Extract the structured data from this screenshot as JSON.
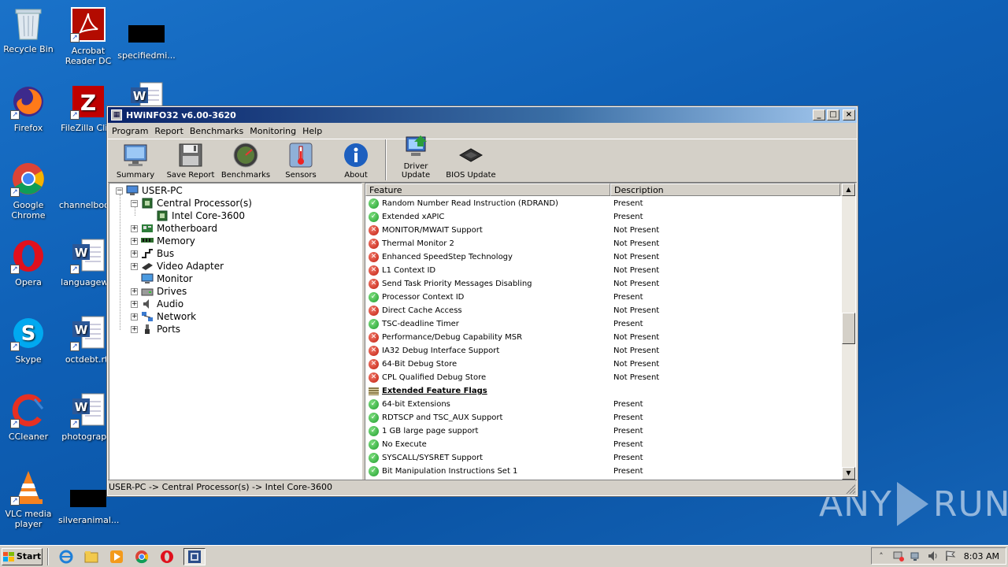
{
  "desktop": {
    "icons": [
      {
        "label": "Recycle Bin",
        "icon": "recycle-bin-icon"
      },
      {
        "label": "Acrobat Reader DC",
        "icon": "acrobat-icon"
      },
      {
        "label": "specifiedmi...",
        "icon": "redacted-icon"
      },
      {
        "label": "Firefox",
        "icon": "firefox-icon"
      },
      {
        "label": "FileZilla Cli...",
        "icon": "filezilla-icon"
      },
      {
        "label": "",
        "icon": "word-doc-icon"
      },
      {
        "label": "Google Chrome",
        "icon": "chrome-icon"
      },
      {
        "label": "channelboo...",
        "icon": "word-doc-icon"
      },
      {
        "label": "Opera",
        "icon": "opera-icon"
      },
      {
        "label": "languagew...",
        "icon": "word-doc-icon"
      },
      {
        "label": "Skype",
        "icon": "skype-icon"
      },
      {
        "label": "octdebt.rtf",
        "icon": "word-doc-icon"
      },
      {
        "label": "CCleaner",
        "icon": "ccleaner-icon"
      },
      {
        "label": "photograp...",
        "icon": "word-doc-icon"
      },
      {
        "label": "VLC media player",
        "icon": "vlc-icon"
      },
      {
        "label": "silveranimal...",
        "icon": "redacted-icon"
      }
    ]
  },
  "window": {
    "title": "HWiNFO32 v6.00-3620",
    "buttons": {
      "minimize": "_",
      "maximize": "□",
      "close": "×"
    }
  },
  "menu": [
    "Program",
    "Report",
    "Benchmarks",
    "Monitoring",
    "Help"
  ],
  "toolbar": [
    {
      "label": "Summary",
      "icon": "monitor-icon"
    },
    {
      "label": "Save Report",
      "icon": "floppy-icon"
    },
    {
      "label": "Benchmarks",
      "icon": "gauge-icon"
    },
    {
      "label": "Sensors",
      "icon": "thermometer-icon"
    },
    {
      "label": "About",
      "icon": "info-icon"
    },
    {
      "label": "Driver Update",
      "icon": "driver-update-icon"
    },
    {
      "label": "BIOS Update",
      "icon": "chip-icon"
    }
  ],
  "tree": {
    "root": "USER-PC",
    "cpu_group": "Central Processor(s)",
    "cpu": "Intel Core-3600",
    "items": [
      "Motherboard",
      "Memory",
      "Bus",
      "Video Adapter",
      "Monitor",
      "Drives",
      "Audio",
      "Network",
      "Ports"
    ]
  },
  "list": {
    "columns": {
      "feature": "Feature",
      "description": "Description"
    },
    "rows": [
      {
        "feature": "Random Number Read Instruction (RDRAND)",
        "description": "Present",
        "status": "yes"
      },
      {
        "feature": "Extended xAPIC",
        "description": "Present",
        "status": "yes"
      },
      {
        "feature": "MONITOR/MWAIT Support",
        "description": "Not Present",
        "status": "no"
      },
      {
        "feature": "Thermal Monitor 2",
        "description": "Not Present",
        "status": "no"
      },
      {
        "feature": "Enhanced SpeedStep Technology",
        "description": "Not Present",
        "status": "no"
      },
      {
        "feature": "L1 Context ID",
        "description": "Not Present",
        "status": "no"
      },
      {
        "feature": "Send Task Priority Messages Disabling",
        "description": "Not Present",
        "status": "no"
      },
      {
        "feature": "Processor Context ID",
        "description": "Present",
        "status": "yes"
      },
      {
        "feature": "Direct Cache Access",
        "description": "Not Present",
        "status": "no"
      },
      {
        "feature": "TSC-deadline Timer",
        "description": "Present",
        "status": "yes"
      },
      {
        "feature": "Performance/Debug Capability MSR",
        "description": "Not Present",
        "status": "no"
      },
      {
        "feature": "IA32 Debug Interface Support",
        "description": "Not Present",
        "status": "no"
      },
      {
        "feature": "64-Bit Debug Store",
        "description": "Not Present",
        "status": "no"
      },
      {
        "feature": "CPL Qualified Debug Store",
        "description": "Not Present",
        "status": "no"
      },
      {
        "feature": "Extended Feature Flags",
        "description": "",
        "status": "section"
      },
      {
        "feature": "64-bit Extensions",
        "description": "Present",
        "status": "yes"
      },
      {
        "feature": "RDTSCP and TSC_AUX Support",
        "description": "Present",
        "status": "yes"
      },
      {
        "feature": "1 GB large page support",
        "description": "Present",
        "status": "yes"
      },
      {
        "feature": "No Execute",
        "description": "Present",
        "status": "yes"
      },
      {
        "feature": "SYSCALL/SYSRET Support",
        "description": "Present",
        "status": "yes"
      },
      {
        "feature": "Bit Manipulation Instructions Set 1",
        "description": "Present",
        "status": "yes"
      }
    ]
  },
  "status_bar": "USER-PC -> Central Processor(s) -> Intel Core-3600",
  "taskbar": {
    "start_label": "Start",
    "apps": [
      "ie-icon",
      "explorer-icon",
      "media-player-icon",
      "chrome-icon",
      "opera-icon",
      "hwinfo-icon"
    ],
    "clock": "8:03 AM"
  },
  "watermark": {
    "left": "ANY",
    "right": "RUN"
  },
  "colors": {
    "present": "#1f9e2e",
    "not_present": "#c21e10",
    "desktop_bg": "#0e5fb5",
    "titlebar": "#0a246a"
  }
}
